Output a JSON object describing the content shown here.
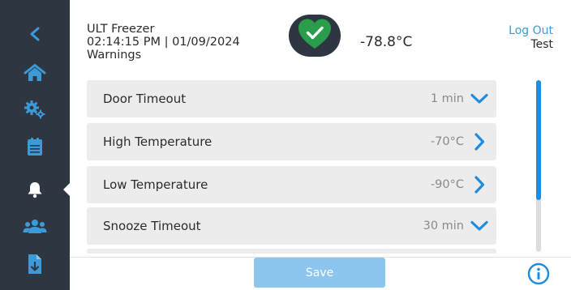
{
  "colors": {
    "sidebar_bg": "#2d3641",
    "accent": "#3b9bd8",
    "status_ok": "#2a9d4d",
    "row_bg": "#ececec",
    "save_disabled": "#8cc6ef"
  },
  "sidebar": {
    "items": [
      {
        "icon": "back-chevron-icon"
      },
      {
        "icon": "home-icon"
      },
      {
        "icon": "settings-gears-icon"
      },
      {
        "icon": "clipboard-log-icon"
      },
      {
        "icon": "bell-icon",
        "active": true
      },
      {
        "icon": "users-icon"
      },
      {
        "icon": "file-download-icon"
      }
    ]
  },
  "header": {
    "device_name": "ULT Freezer",
    "datetime": "02:14:15 PM | 01/09/2024",
    "section": "Warnings",
    "status_icon": "heart-check-icon",
    "temperature": "-78.8°C",
    "logout_label": "Log Out",
    "user_name": "Test"
  },
  "settings": {
    "rows": [
      {
        "label": "Door Timeout",
        "value": "1 min",
        "icon": "chevron-down-icon"
      },
      {
        "label": "High Temperature",
        "value": "-70°C",
        "icon": "chevron-right-icon"
      },
      {
        "label": "Low Temperature",
        "value": "-90°C",
        "icon": "chevron-right-icon"
      },
      {
        "label": "Snooze Timeout",
        "value": "30 min",
        "icon": "chevron-down-icon"
      }
    ]
  },
  "scroll": {
    "thumb_fraction": 0.7
  },
  "footer": {
    "save_label": "Save",
    "info_icon": "info-icon"
  }
}
